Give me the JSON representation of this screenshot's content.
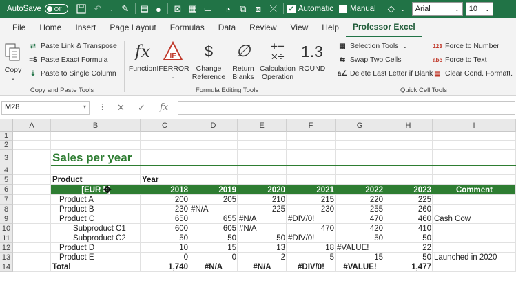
{
  "qat": {
    "autosave_label": "AutoSave",
    "autosave_state": "Off",
    "automatic_label": "Automatic",
    "manual_label": "Manual",
    "font_name": "Arial",
    "font_size": "10"
  },
  "tabs": [
    "File",
    "Home",
    "Insert",
    "Page Layout",
    "Formulas",
    "Data",
    "Review",
    "View",
    "Help",
    "Professor Excel"
  ],
  "active_tab": "Professor Excel",
  "ribbon": {
    "copy_group": {
      "copy_label": "Copy",
      "paste_link": "Paste Link & Transpose",
      "paste_exact": "Paste Exact Formula",
      "paste_single": "Paste to Single Column",
      "group_label": "Copy and Paste Tools"
    },
    "formula_group": {
      "function_label": "Function",
      "iferror_label": "IFERROR",
      "change_ref_line1": "Change",
      "change_ref_line2": "Reference",
      "return_blanks_line1": "Return",
      "return_blanks_line2": "Blanks",
      "calc_op_line1": "Calculation",
      "calc_op_line2": "Operation",
      "round_label": "ROUND",
      "group_label": "Formula Editing Tools"
    },
    "quick_group": {
      "selection_tools": "Selection Tools",
      "swap_cells": "Swap Two Cells",
      "delete_last": "Delete Last Letter if Blank",
      "force_number": "Force to Number",
      "force_text": "Force to Text",
      "clear_cond": "Clear Cond. Formatt.",
      "group_label": "Quick Cell Tools"
    }
  },
  "formula_bar": {
    "name_box": "M28",
    "fx_label": "fx",
    "formula": ""
  },
  "columns": [
    "A",
    "B",
    "C",
    "D",
    "E",
    "F",
    "G",
    "H",
    "I"
  ],
  "rows": [
    "1",
    "2",
    "3",
    "4",
    "5",
    "6",
    "7",
    "8",
    "9",
    "10",
    "11",
    "12",
    "13",
    "14"
  ],
  "sheet": {
    "title": "Sales per year",
    "product_label": "Product",
    "year_label": "Year",
    "header_unit": "[EUR k]",
    "years": [
      "2018",
      "2019",
      "2020",
      "2021",
      "2022",
      "2023"
    ],
    "comment_label": "Comment",
    "data_rows": [
      {
        "name": "Product A",
        "indent": 1,
        "values": [
          "200",
          "205",
          "210",
          "215",
          "220",
          "225"
        ],
        "comment": ""
      },
      {
        "name": "Product B",
        "indent": 1,
        "values": [
          "230",
          "#N/A",
          "225",
          "230",
          "255",
          "260"
        ],
        "comment": ""
      },
      {
        "name": "Product C",
        "indent": 1,
        "values": [
          "650",
          "655",
          "#N/A",
          "#DIV/0!",
          "470",
          "460"
        ],
        "comment": "Cash Cow"
      },
      {
        "name": "Subproduct C1",
        "indent": 2,
        "values": [
          "600",
          "605",
          "#N/A",
          "470",
          "420",
          "410"
        ],
        "comment": ""
      },
      {
        "name": "Subproduct C2",
        "indent": 2,
        "values": [
          "50",
          "50",
          "50",
          "#DIV/0!",
          "50",
          "50"
        ],
        "comment": ""
      },
      {
        "name": "Product D",
        "indent": 1,
        "values": [
          "10",
          "15",
          "13",
          "18",
          "#VALUE!",
          "22"
        ],
        "comment": ""
      },
      {
        "name": "Product E",
        "indent": 1,
        "values": [
          "0",
          "0",
          "2",
          "5",
          "15",
          "50"
        ],
        "comment": "Launched in 2020"
      }
    ],
    "total_row": {
      "name": "Total",
      "values": [
        "1,740",
        "#N/A",
        "#N/A",
        "#DIV/0!",
        "#VALUE!",
        "1,477"
      ]
    }
  },
  "colors": {
    "excel_green": "#217346",
    "header_fill": "#2e7d32",
    "title_color": "#2e7d32"
  }
}
